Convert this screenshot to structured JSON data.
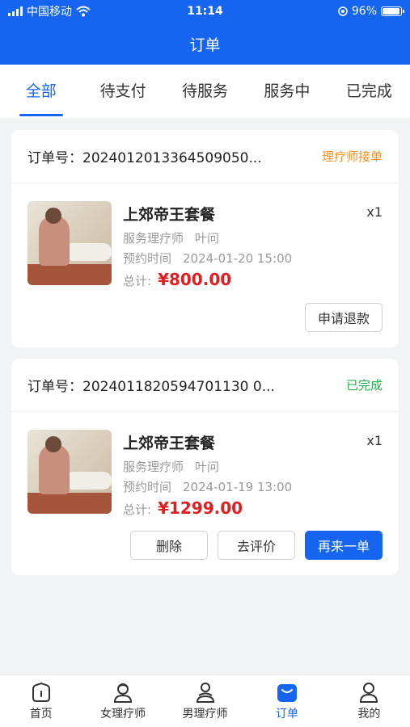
{
  "status_bar": {
    "carrier": "中国移动",
    "time": "11:14",
    "battery_percent": "96%",
    "battery_level": 0.96,
    "icons": [
      "signal-icon",
      "wifi-icon",
      "location-icon",
      "battery-icon"
    ]
  },
  "header": {
    "title": "订单"
  },
  "tabs": [
    {
      "label": "全部",
      "active": true
    },
    {
      "label": "待支付",
      "active": false
    },
    {
      "label": "待服务",
      "active": false
    },
    {
      "label": "服务中",
      "active": false
    },
    {
      "label": "已完成",
      "active": false
    }
  ],
  "orders": [
    {
      "order_label": "订单号：",
      "order_no": "2024012013364509050...",
      "status": "理疗师接单",
      "status_color": "#f5921f",
      "product_name": "上郊帝王套餐",
      "quantity": "x1",
      "therapist_label": "服务理疗师",
      "therapist_name": "叶问",
      "time_label": "预约时间",
      "time_value": "2024-01-20 15:00",
      "total_label": "总计:",
      "price": "¥800.00",
      "buttons": [
        "申请退款"
      ]
    },
    {
      "order_label": "订单号：",
      "order_no": "2024011820594701130 0...",
      "status": "已完成",
      "status_color": "#22b14c",
      "product_name": "上郊帝王套餐",
      "quantity": "x1",
      "therapist_label": "服务理疗师",
      "therapist_name": "叶问",
      "time_label": "预约时间",
      "time_value": "2024-01-19 13:00",
      "total_label": "总计:",
      "price": "¥1299.00",
      "buttons": [
        "删除",
        "去评价",
        "再来一单"
      ]
    }
  ],
  "tabbar": [
    {
      "label": "首页",
      "icon": "home-icon",
      "active": false
    },
    {
      "label": "女理疗师",
      "icon": "female-therapist-icon",
      "active": false
    },
    {
      "label": "男理疗师",
      "icon": "male-therapist-icon",
      "active": false
    },
    {
      "label": "订单",
      "icon": "orders-icon",
      "active": true
    },
    {
      "label": "我的",
      "icon": "profile-icon",
      "active": false
    }
  ],
  "colors": {
    "primary": "#1565f0",
    "price": "#e02020",
    "background": "#f2f3f5"
  }
}
